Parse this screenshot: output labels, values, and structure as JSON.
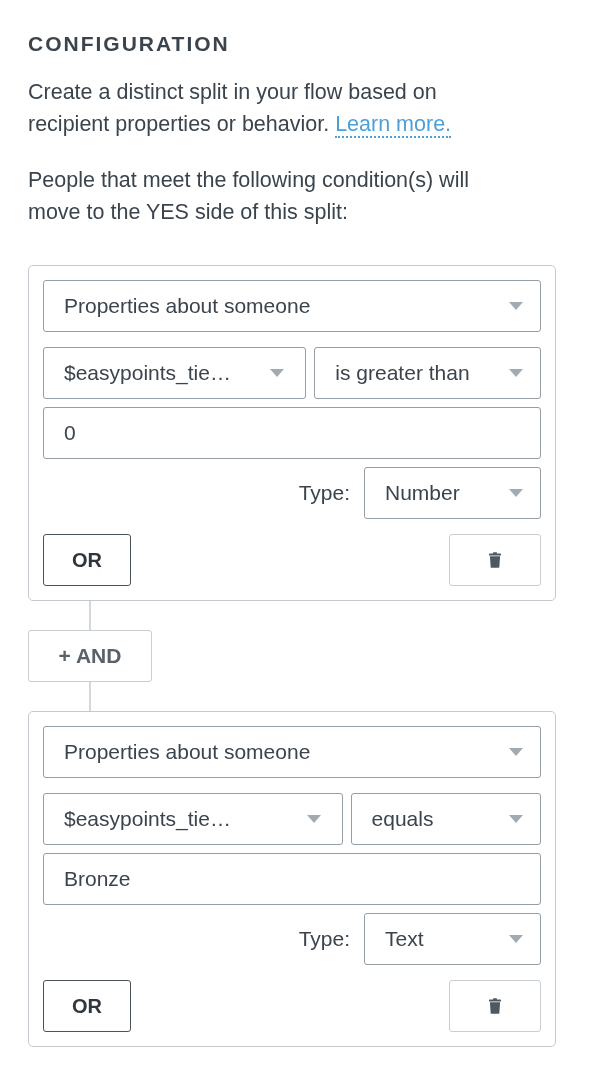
{
  "section": {
    "title": "CONFIGURATION"
  },
  "description": {
    "text": "Create a distinct split in your flow based on recipient properties or behavior.",
    "link": "Learn more."
  },
  "instruction": "People that meet the following condition(s) will move to the YES side of this split:",
  "blocks": [
    {
      "kind": "condition",
      "category": "Properties about someone",
      "property": "$easypoints_tie…",
      "operator": "is greater than",
      "value": "0",
      "type_label": "Type:",
      "type": "Number",
      "or_label": "OR"
    },
    {
      "kind": "and_button",
      "label": "+ AND"
    },
    {
      "kind": "condition",
      "category": "Properties about someone",
      "property": "$easypoints_tie…",
      "operator": "equals",
      "value": "Bronze",
      "type_label": "Type:",
      "type": "Text",
      "or_label": "OR"
    }
  ]
}
